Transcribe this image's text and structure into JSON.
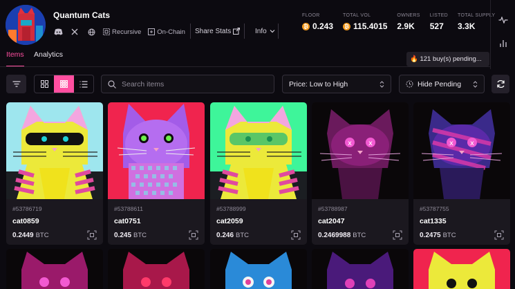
{
  "collection": {
    "name": "Quantum Cats",
    "tags": [
      "Recursive",
      "On-Chain"
    ],
    "share_label": "Share Stats",
    "info_label": "Info"
  },
  "stats": [
    {
      "label": "FLOOR",
      "value": "0.243"
    },
    {
      "label": "TOTAL VOL",
      "value": "115.4015"
    },
    {
      "label": "OWNERS",
      "value": "2.9K"
    },
    {
      "label": "LISTED",
      "value": "527"
    },
    {
      "label": "TOTAL SUPPLY",
      "value": "3.3K"
    }
  ],
  "pending_banner": "🔥 121 buy(s) pending...",
  "tabs": [
    {
      "label": "Items",
      "active": true
    },
    {
      "label": "Analytics",
      "active": false
    }
  ],
  "toolbar": {
    "search_placeholder": "Search items",
    "sort_value": "Price: Low to High",
    "pending_filter_value": "Hide Pending"
  },
  "currency": "BTC",
  "items": [
    {
      "id": "#53786719",
      "name": "cat0859",
      "price": "0.2449",
      "bg": "#9ee6ee"
    },
    {
      "id": "#53788611",
      "name": "cat0751",
      "price": "0.245",
      "bg": "#f0244e"
    },
    {
      "id": "#53788999",
      "name": "cat2059",
      "price": "0.246",
      "bg": "#3ef59a"
    },
    {
      "id": "#53788987",
      "name": "cat2047",
      "price": "0.2469988",
      "bg": "#0a0709"
    },
    {
      "id": "#53787755",
      "name": "cat1335",
      "price": "0.2475",
      "bg": "#0a0709"
    }
  ],
  "colors": {
    "accent": "#ff4fa0",
    "bitcoin": "#f39a1e",
    "background": "#0c0a10"
  }
}
